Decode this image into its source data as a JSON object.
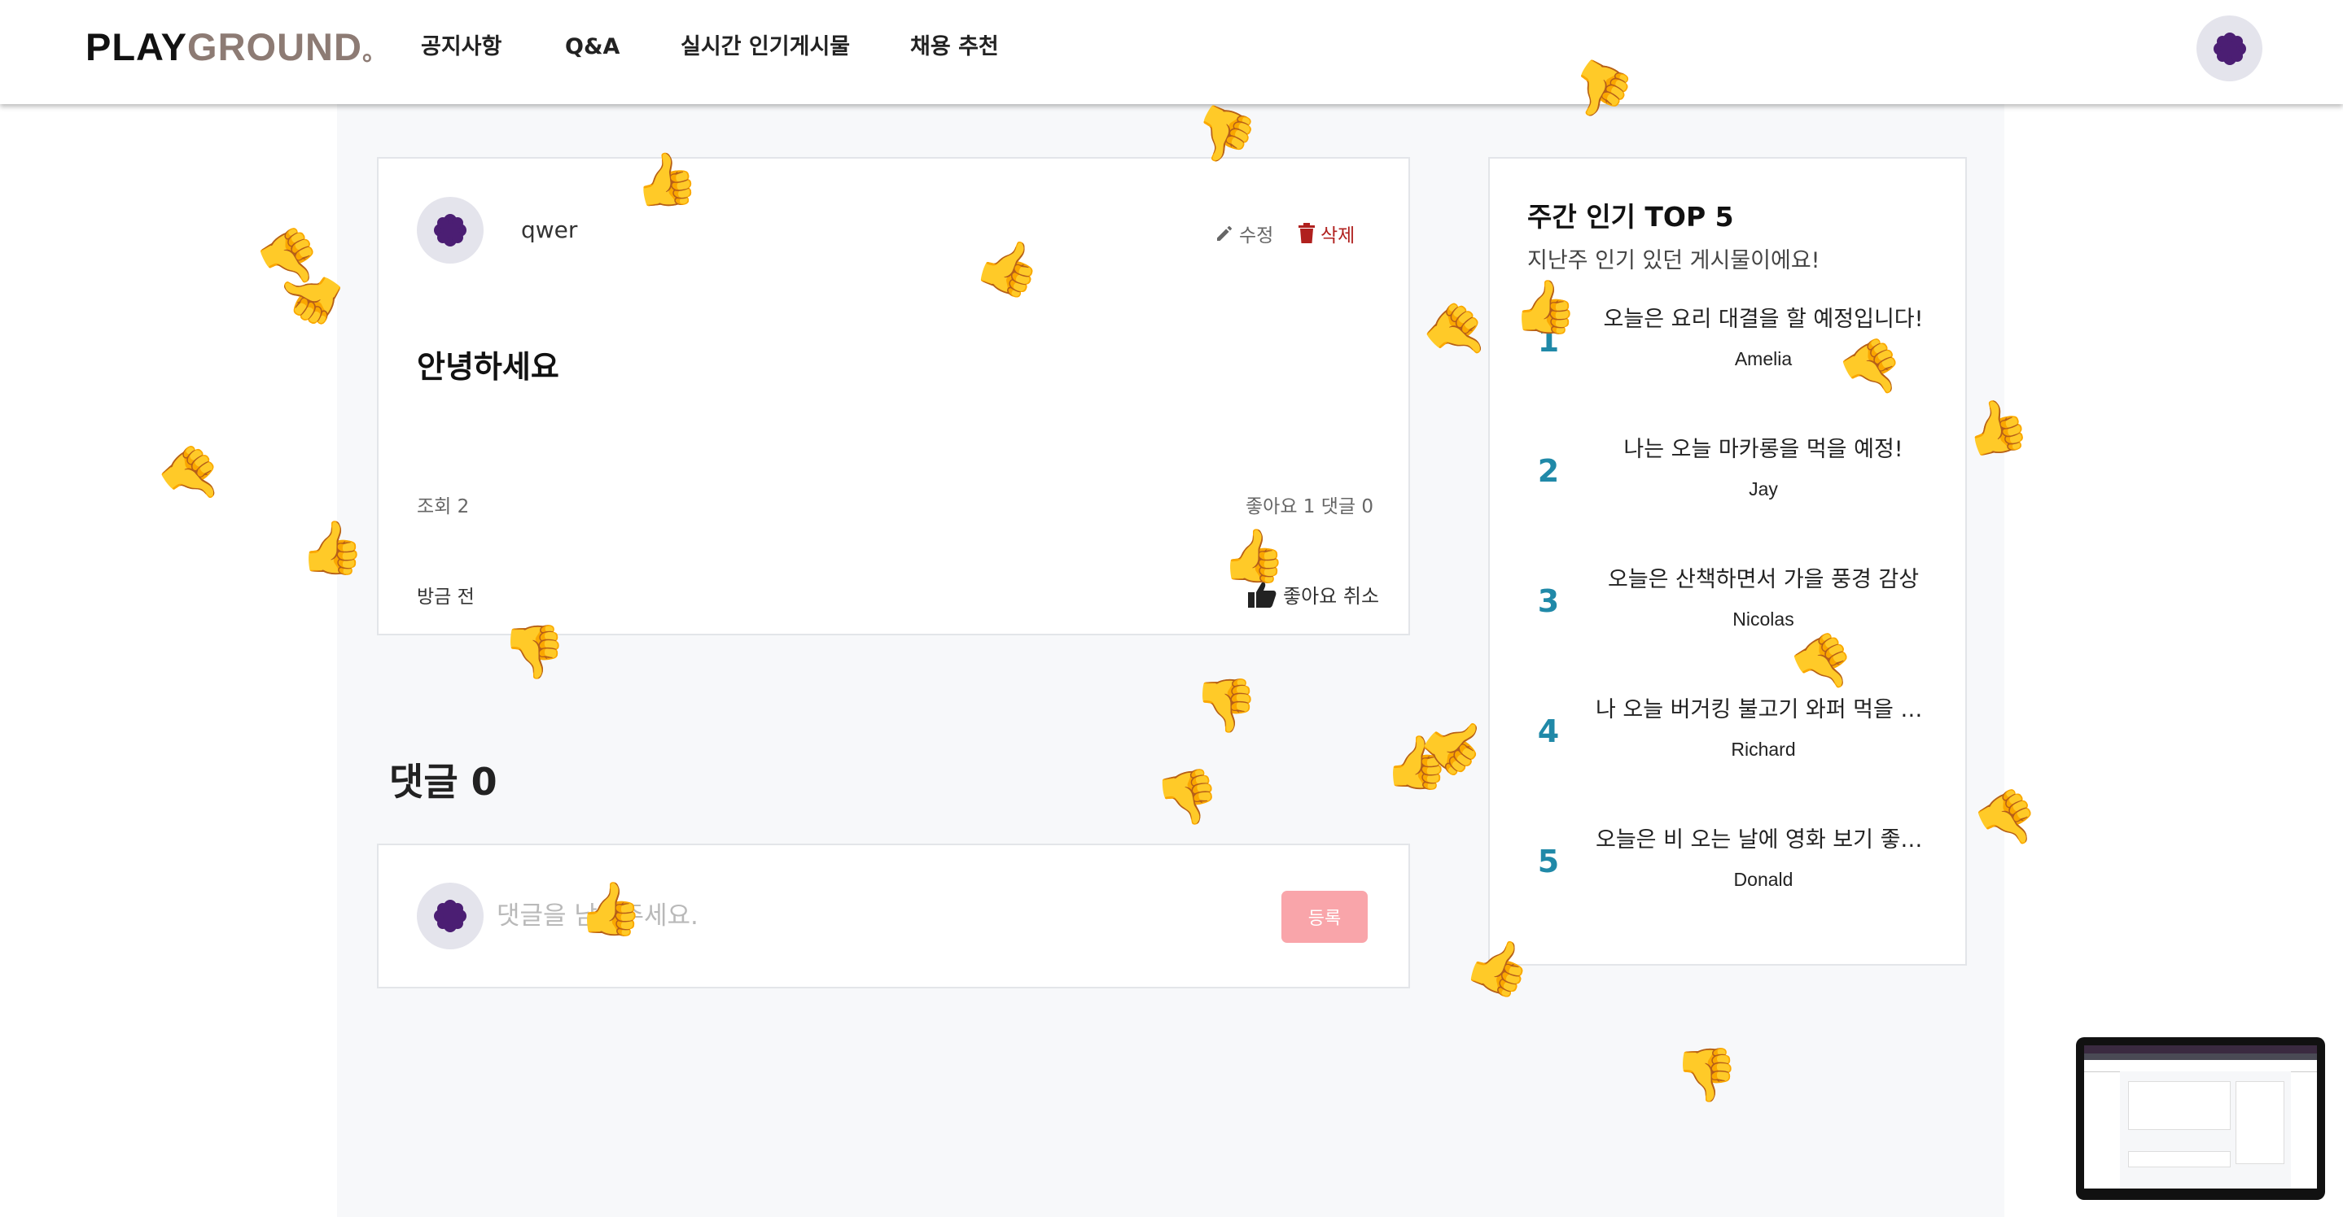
{
  "header": {
    "logo_primary": "PLAY",
    "logo_secondary": "GROUND",
    "logo_dot": "。",
    "nav": [
      "공지사항",
      "Q&A",
      "실시간 인기게시물",
      "채용 추천"
    ]
  },
  "post": {
    "author": "qwer",
    "edit_label": "수정",
    "delete_label": "삭제",
    "title": "안녕하세요",
    "views": "조회 2",
    "stats": "좋아요 1 댓글 0",
    "time": "방금 전",
    "like_cancel_label": "좋아요 취소"
  },
  "comments": {
    "heading": "댓글 0",
    "placeholder": "댓글을 남겨주세요.",
    "submit_label": "등록"
  },
  "sidebar": {
    "title": "주간 인기 TOP 5",
    "subtitle": "지난주 인기 있던 게시물이에요!",
    "items": [
      {
        "rank": "1",
        "title": "오늘은 요리 대결을 할 예정입니다!",
        "author": "Amelia"
      },
      {
        "rank": "2",
        "title": "나는 오늘 마카롱을 먹을 예정!",
        "author": "Jay"
      },
      {
        "rank": "3",
        "title": "오늘은 산책하면서 가을 풍경 감상",
        "author": "Nicolas"
      },
      {
        "rank": "4",
        "title": "나 오늘 버거킹 불고기 와퍼 먹을 예정",
        "author": "Richard"
      },
      {
        "rank": "5",
        "title": "오늘은 비 오는 날에 영화 보기 좋은 날",
        "author": "Donald"
      }
    ]
  },
  "icons": {
    "avatar": "purple-flower-avatar-icon",
    "edit": "pencil-icon",
    "delete": "trash-icon",
    "like": "thumbs-up-icon",
    "reaction_up": "👍",
    "reaction_down": "👎"
  },
  "colors": {
    "accent_rank": "#2089a8",
    "delete": "#b0201e",
    "submit_button": "#f9a5aa",
    "logo_secondary": "#8d7b74",
    "avatar_flower": "#4b1e73"
  }
}
